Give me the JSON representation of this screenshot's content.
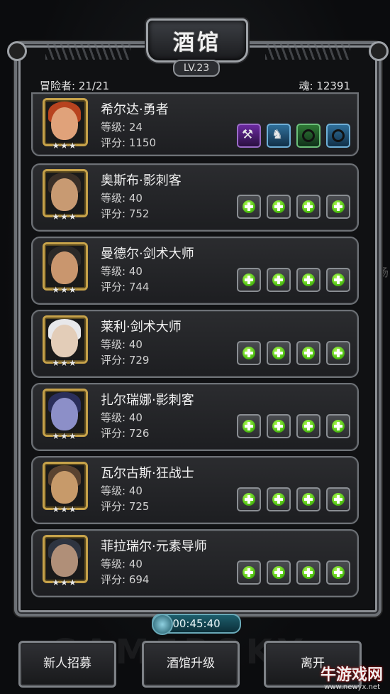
{
  "title": "酒馆",
  "level_badge": "LV.23",
  "stats": {
    "adventurers_label": "冒险者:",
    "adventurers_value": "21/21",
    "soul_label": "魂:",
    "soul_value": "12391"
  },
  "stars": "★★★",
  "heroes": [
    {
      "name": "希尔达·勇者",
      "level": "等级: 24",
      "score": "评分: 1150",
      "slots": "equipped"
    },
    {
      "name": "奥斯布·影刺客",
      "level": "等级: 40",
      "score": "评分: 752",
      "slots": "empty"
    },
    {
      "name": "曼德尔·剑术大师",
      "level": "等级: 40",
      "score": "评分: 744",
      "slots": "empty"
    },
    {
      "name": "莱利·剑术大师",
      "level": "等级: 40",
      "score": "评分: 729",
      "slots": "empty"
    },
    {
      "name": "扎尔瑞娜·影刺客",
      "level": "等级: 40",
      "score": "评分: 726",
      "slots": "empty"
    },
    {
      "name": "瓦尔古斯·狂战士",
      "level": "等级: 40",
      "score": "评分: 725",
      "slots": "empty"
    },
    {
      "name": "菲拉瑞尔·元素导师",
      "level": "等级: 40",
      "score": "评分: 694",
      "slots": "empty"
    }
  ],
  "portrait_colors": [
    {
      "face": "#e0a27a",
      "hair": "#b8431f"
    },
    {
      "face": "#c89a72",
      "hair": "#3a2f27"
    },
    {
      "face": "#c9966e",
      "hair": "#2c2a28"
    },
    {
      "face": "#e3cdb8",
      "hair": "#e8e8ea"
    },
    {
      "face": "#8c8fc8",
      "hair": "#2a2e5a"
    },
    {
      "face": "#c79a6a",
      "hair": "#5a4330"
    },
    {
      "face": "#b08f78",
      "hair": "#2e3440"
    }
  ],
  "equipment_icons": [
    "axe-icon",
    "armor-icon",
    "ring-icon",
    "ring-icon"
  ],
  "timer": "00:45:40",
  "buttons": {
    "recruit": "新人招募",
    "upgrade": "酒馆升级",
    "leave": "离开"
  },
  "watermark": "GAMERSKY",
  "site_logo": "牛游戏网",
  "site_url": "www.newyx.net",
  "side_glyph": "场"
}
